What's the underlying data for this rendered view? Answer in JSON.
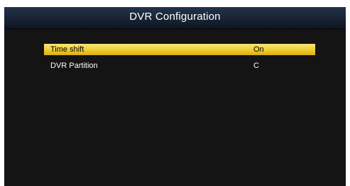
{
  "screen": {
    "title": "DVR Configuration"
  },
  "menu": {
    "items": [
      {
        "label": "Time shift",
        "value": "On",
        "selected": true
      },
      {
        "label": "DVR Partition",
        "value": "C",
        "selected": false
      }
    ]
  },
  "colors": {
    "background": "#141414",
    "title_bar": "#1a2638",
    "highlight": "#f1d23c",
    "text": "#ffffff",
    "selected_text": "#000000"
  }
}
